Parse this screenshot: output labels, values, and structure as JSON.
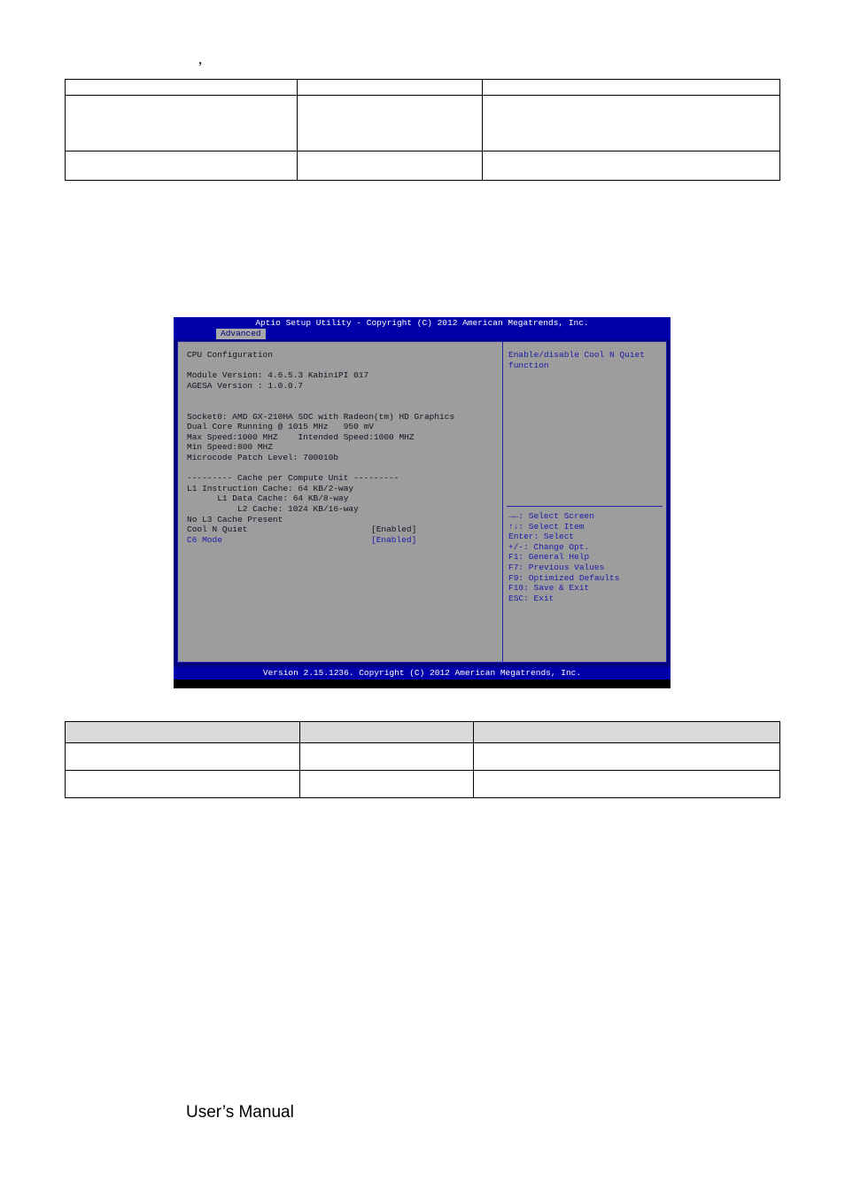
{
  "document": {
    "stray_mark": ",",
    "footer_label": "User’s Manual"
  },
  "table_top": {
    "rows": [
      [
        "",
        "",
        ""
      ],
      [
        "",
        "",
        ""
      ],
      [
        "",
        "",
        ""
      ]
    ]
  },
  "table_bottom": {
    "header": [
      "",
      "",
      ""
    ],
    "rows": [
      [
        "",
        "",
        ""
      ],
      [
        "",
        "",
        ""
      ]
    ]
  },
  "bios": {
    "title": "Aptio Setup Utility - Copyright (C) 2012 American Megatrends, Inc.",
    "active_tab": "Advanced",
    "footer_version": "Version 2.15.1236. Copyright (C) 2012 American Megatrends, Inc.",
    "colors": {
      "title_bg": "#0000aa",
      "panel_bg": "#9d9d9d",
      "border": "#2222aa",
      "text": "#111122",
      "highlight_text": "#1a1aa8",
      "tab_bg": "#a8a8a8",
      "tab_text": "#00007c"
    },
    "left_pane": {
      "section_title": "CPU Configuration",
      "lines": [
        "Module Version: 4.6.5.3 KabiniPI 017",
        "AGESA Version : 1.0.0.7",
        "",
        "",
        "Socket0: AMD GX-210HA SOC with Radeon(tm) HD Graphics",
        "Dual Core Running @ 1015 MHz   950 mV",
        "Max Speed:1000 MHZ    Intended Speed:1000 MHZ",
        "Min Speed:800 MHZ",
        "Microcode Patch Level: 700010b",
        "",
        "--------- Cache per Compute Unit ---------",
        "L1 Instruction Cache: 64 KB/2-way",
        "      L1 Data Cache: 64 KB/8-way",
        "          L2 Cache: 1024 KB/16-way",
        "No L3 Cache Present"
      ],
      "options": [
        {
          "name": "Cool N Quiet",
          "value": "[Enabled]",
          "selected": false
        },
        {
          "name": "C6 Mode",
          "value": "[Enabled]",
          "selected": true
        }
      ]
    },
    "right_pane": {
      "help_text_line1": "Enable/disable Cool N Quiet",
      "help_text_line2": "function",
      "hotkeys": [
        "→←: Select Screen",
        "↑↓: Select Item",
        "Enter: Select",
        "+/-: Change Opt.",
        "F1: General Help",
        "F7: Previous Values",
        "F9: Optimized Defaults",
        "F10: Save & Exit",
        "ESC: Exit"
      ]
    }
  }
}
